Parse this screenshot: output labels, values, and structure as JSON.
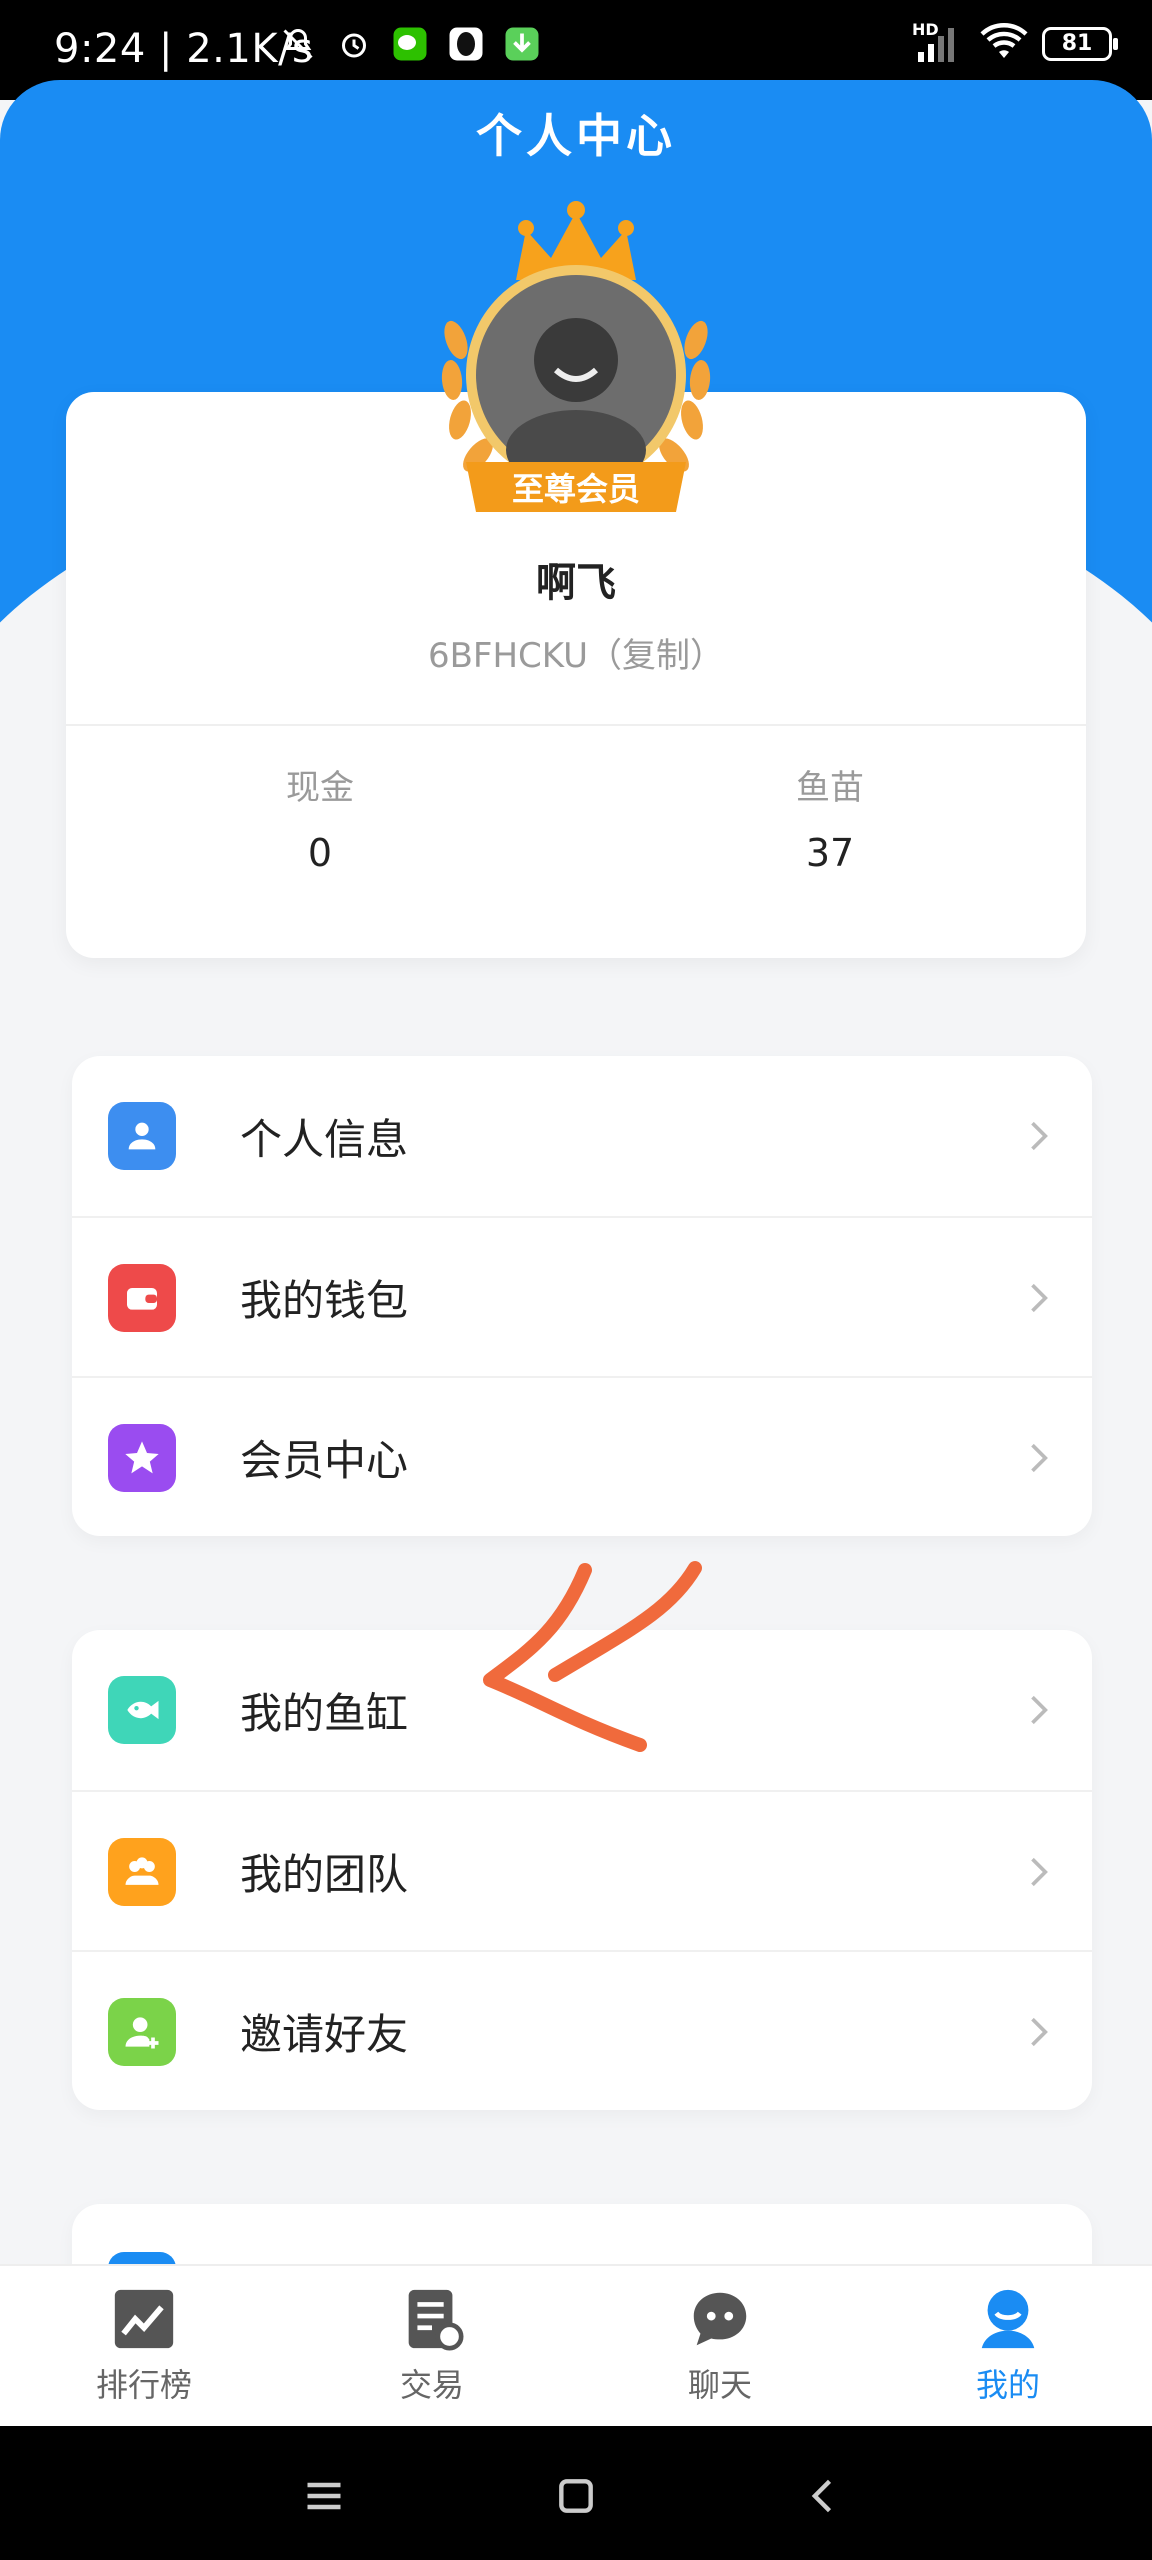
{
  "status_bar": {
    "time": "9:24",
    "network_speed": "2.1K/s",
    "battery": "81",
    "hd_label": "HD"
  },
  "header": {
    "title": "个人中心"
  },
  "profile": {
    "badge": "至尊会员",
    "nickname": "啊飞",
    "user_id": "6BFHCKU（复制）",
    "stats": [
      {
        "label": "现金",
        "value": "0"
      },
      {
        "label": "鱼苗",
        "value": "37"
      }
    ]
  },
  "menu_group_1": [
    {
      "label": "个人信息",
      "icon": "person-icon",
      "color": "#3d8ef0"
    },
    {
      "label": "我的钱包",
      "icon": "wallet-icon",
      "color": "#ee4a4a"
    },
    {
      "label": "会员中心",
      "icon": "star-icon",
      "color": "#9a4cf0"
    }
  ],
  "menu_group_2": [
    {
      "label": "我的鱼缸",
      "icon": "fish-icon",
      "color": "#3fd6b8"
    },
    {
      "label": "我的团队",
      "icon": "team-icon",
      "color": "#ffa21d"
    },
    {
      "label": "邀请好友",
      "icon": "add-user-icon",
      "color": "#7bd349"
    }
  ],
  "bottom_nav": [
    {
      "label": "排行榜",
      "icon": "chart-icon",
      "active": false
    },
    {
      "label": "交易",
      "icon": "trade-icon",
      "active": false
    },
    {
      "label": "聊天",
      "icon": "chat-icon",
      "active": false
    },
    {
      "label": "我的",
      "icon": "profile-icon",
      "active": true
    }
  ],
  "colors": {
    "primary": "#1a8cf3",
    "annotation": "#f06a3c"
  }
}
